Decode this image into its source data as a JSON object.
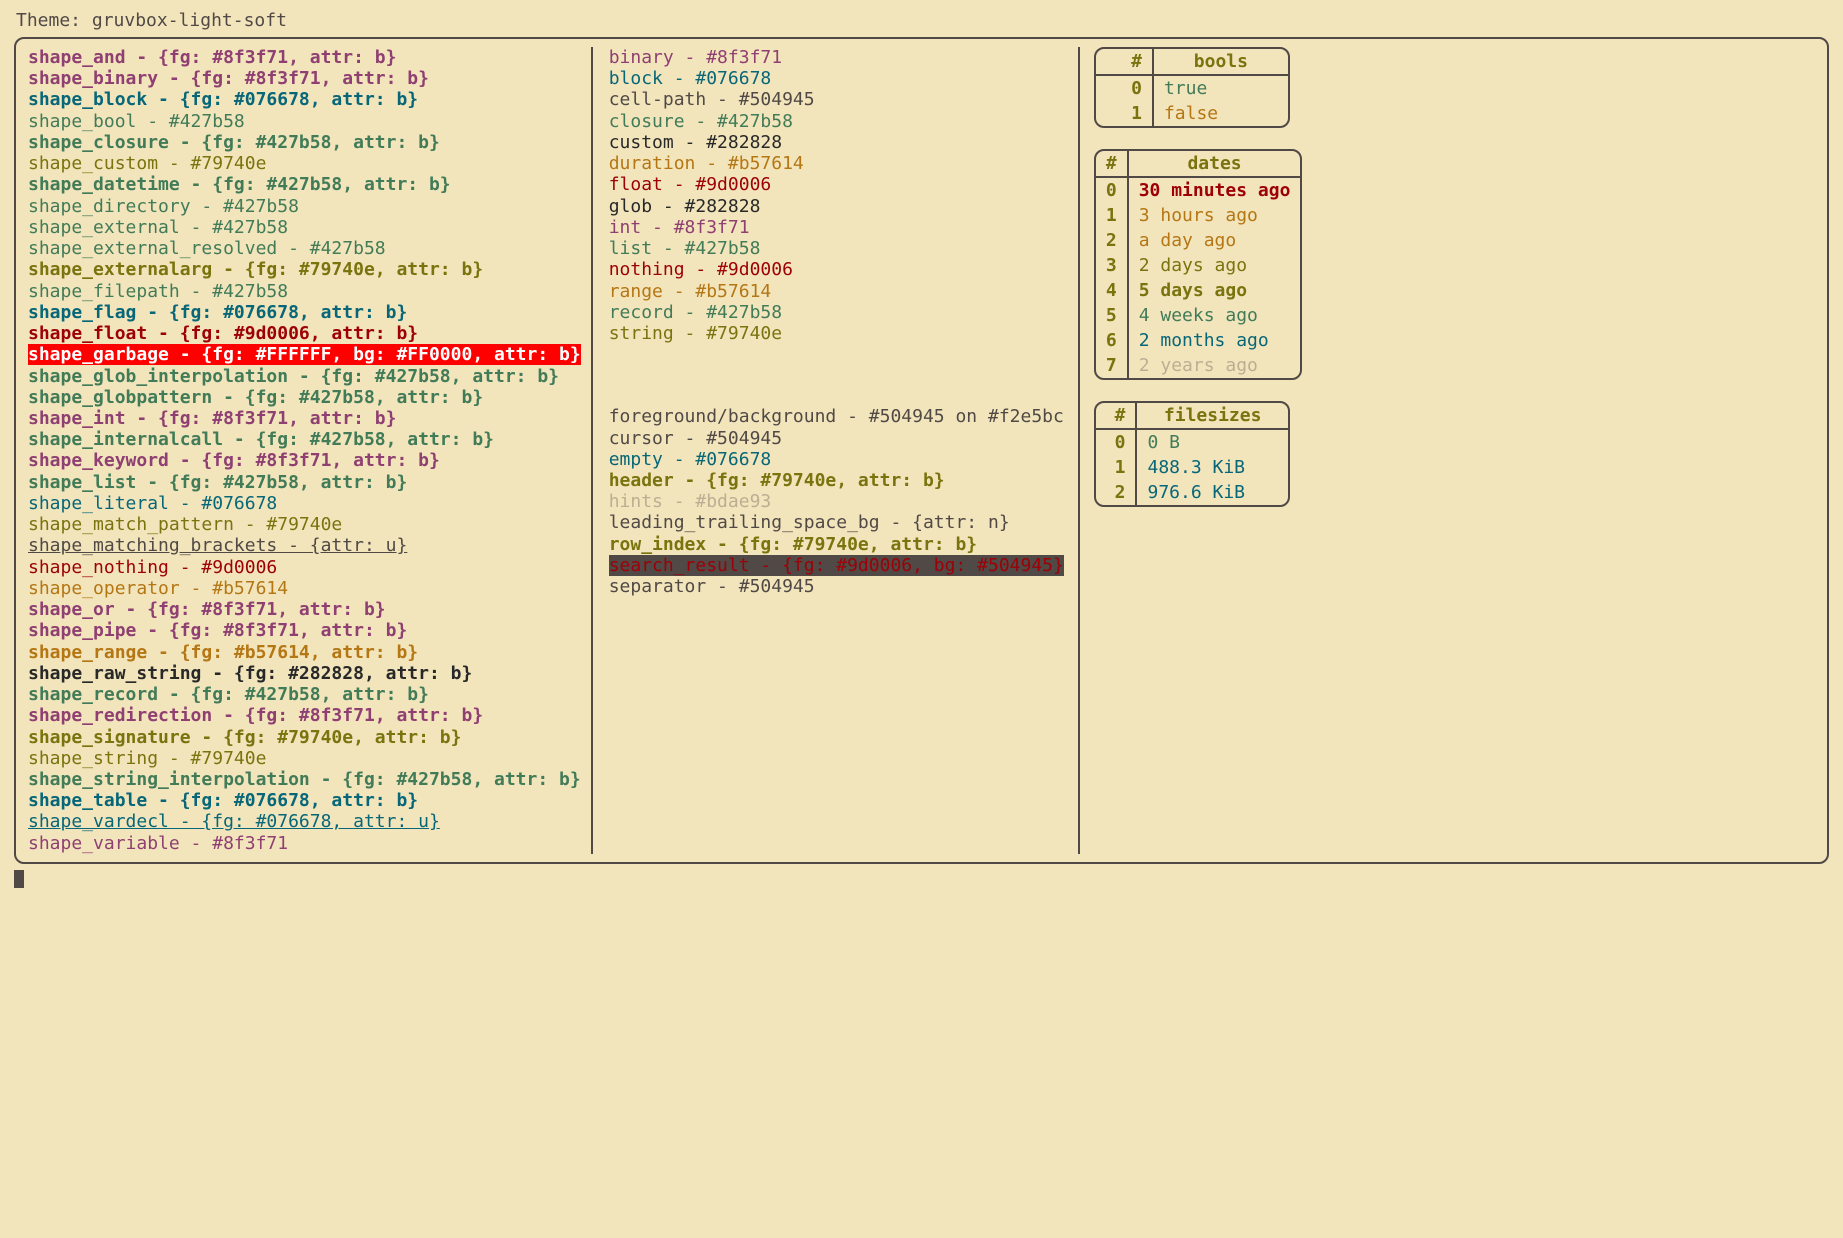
{
  "theme_label": "Theme: gruvbox-light-soft",
  "shapes": [
    {
      "name": "shape_and",
      "value": "{fg: #8f3f71, attr: b}",
      "color": "#8f3f71",
      "bold": true
    },
    {
      "name": "shape_binary",
      "value": "{fg: #8f3f71, attr: b}",
      "color": "#8f3f71",
      "bold": true
    },
    {
      "name": "shape_block",
      "value": "{fg: #076678, attr: b}",
      "color": "#076678",
      "bold": true
    },
    {
      "name": "shape_bool",
      "value": "#427b58",
      "color": "#427b58",
      "bold": false
    },
    {
      "name": "shape_closure",
      "value": "{fg: #427b58, attr: b}",
      "color": "#427b58",
      "bold": true
    },
    {
      "name": "shape_custom",
      "value": "#79740e",
      "color": "#79740e",
      "bold": false
    },
    {
      "name": "shape_datetime",
      "value": "{fg: #427b58, attr: b}",
      "color": "#427b58",
      "bold": true
    },
    {
      "name": "shape_directory",
      "value": "#427b58",
      "color": "#427b58",
      "bold": false
    },
    {
      "name": "shape_external",
      "value": "#427b58",
      "color": "#427b58",
      "bold": false
    },
    {
      "name": "shape_external_resolved",
      "value": "#427b58",
      "color": "#427b58",
      "bold": false
    },
    {
      "name": "shape_externalarg",
      "value": "{fg: #79740e, attr: b}",
      "color": "#79740e",
      "bold": true
    },
    {
      "name": "shape_filepath",
      "value": "#427b58",
      "color": "#427b58",
      "bold": false
    },
    {
      "name": "shape_flag",
      "value": "{fg: #076678, attr: b}",
      "color": "#076678",
      "bold": true
    },
    {
      "name": "shape_float",
      "value": "{fg: #9d0006, attr: b}",
      "color": "#9d0006",
      "bold": true
    },
    {
      "name": "shape_garbage",
      "value": "{fg: #FFFFFF, bg: #FF0000, attr: b}",
      "color": "#FFFFFF",
      "bg": "#FF0000",
      "bold": true
    },
    {
      "name": "shape_glob_interpolation",
      "value": "{fg: #427b58, attr: b}",
      "color": "#427b58",
      "bold": true
    },
    {
      "name": "shape_globpattern",
      "value": "{fg: #427b58, attr: b}",
      "color": "#427b58",
      "bold": true
    },
    {
      "name": "shape_int",
      "value": "{fg: #8f3f71, attr: b}",
      "color": "#8f3f71",
      "bold": true
    },
    {
      "name": "shape_internalcall",
      "value": "{fg: #427b58, attr: b}",
      "color": "#427b58",
      "bold": true
    },
    {
      "name": "shape_keyword",
      "value": "{fg: #8f3f71, attr: b}",
      "color": "#8f3f71",
      "bold": true
    },
    {
      "name": "shape_list",
      "value": "{fg: #427b58, attr: b}",
      "color": "#427b58",
      "bold": true
    },
    {
      "name": "shape_literal",
      "value": "#076678",
      "color": "#076678",
      "bold": false
    },
    {
      "name": "shape_match_pattern",
      "value": "#79740e",
      "color": "#79740e",
      "bold": false
    },
    {
      "name": "shape_matching_brackets",
      "value": "{attr: u}",
      "color": "#504945",
      "underline": true
    },
    {
      "name": "shape_nothing",
      "value": "#9d0006",
      "color": "#9d0006",
      "bold": false
    },
    {
      "name": "shape_operator",
      "value": "#b57614",
      "color": "#b57614",
      "bold": false
    },
    {
      "name": "shape_or",
      "value": "{fg: #8f3f71, attr: b}",
      "color": "#8f3f71",
      "bold": true
    },
    {
      "name": "shape_pipe",
      "value": "{fg: #8f3f71, attr: b}",
      "color": "#8f3f71",
      "bold": true
    },
    {
      "name": "shape_range",
      "value": "{fg: #b57614, attr: b}",
      "color": "#b57614",
      "bold": true
    },
    {
      "name": "shape_raw_string",
      "value": "{fg: #282828, attr: b}",
      "color": "#282828",
      "bold": true
    },
    {
      "name": "shape_record",
      "value": "{fg: #427b58, attr: b}",
      "color": "#427b58",
      "bold": true
    },
    {
      "name": "shape_redirection",
      "value": "{fg: #8f3f71, attr: b}",
      "color": "#8f3f71",
      "bold": true
    },
    {
      "name": "shape_signature",
      "value": "{fg: #79740e, attr: b}",
      "color": "#79740e",
      "bold": true
    },
    {
      "name": "shape_string",
      "value": "#79740e",
      "color": "#79740e",
      "bold": false
    },
    {
      "name": "shape_string_interpolation",
      "value": "{fg: #427b58, attr: b}",
      "color": "#427b58",
      "bold": true
    },
    {
      "name": "shape_table",
      "value": "{fg: #076678, attr: b}",
      "color": "#076678",
      "bold": true
    },
    {
      "name": "shape_vardecl",
      "value": "{fg: #076678, attr: u}",
      "color": "#076678",
      "underline": true
    },
    {
      "name": "shape_variable",
      "value": "#8f3f71",
      "color": "#8f3f71",
      "bold": false
    }
  ],
  "types": [
    {
      "name": "binary",
      "value": "#8f3f71",
      "color": "#8f3f71"
    },
    {
      "name": "block",
      "value": "#076678",
      "color": "#076678"
    },
    {
      "name": "cell-path",
      "value": "#504945",
      "color": "#504945"
    },
    {
      "name": "closure",
      "value": "#427b58",
      "color": "#427b58"
    },
    {
      "name": "custom",
      "value": "#282828",
      "color": "#282828"
    },
    {
      "name": "duration",
      "value": "#b57614",
      "color": "#b57614"
    },
    {
      "name": "float",
      "value": "#9d0006",
      "color": "#9d0006"
    },
    {
      "name": "glob",
      "value": "#282828",
      "color": "#282828"
    },
    {
      "name": "int",
      "value": "#8f3f71",
      "color": "#8f3f71"
    },
    {
      "name": "list",
      "value": "#427b58",
      "color": "#427b58"
    },
    {
      "name": "nothing",
      "value": "#9d0006",
      "color": "#9d0006"
    },
    {
      "name": "range",
      "value": "#b57614",
      "color": "#b57614"
    },
    {
      "name": "record",
      "value": "#427b58",
      "color": "#427b58"
    },
    {
      "name": "string",
      "value": "#79740e",
      "color": "#79740e"
    }
  ],
  "misc": [
    {
      "name": "foreground/background",
      "value": "#504945 on #f2e5bc",
      "color": "#504945"
    },
    {
      "name": "cursor",
      "value": "#504945",
      "color": "#504945"
    },
    {
      "name": "empty",
      "value": "#076678",
      "color": "#076678"
    },
    {
      "name": "header",
      "value": "{fg: #79740e, attr: b}",
      "color": "#79740e",
      "bold": true
    },
    {
      "name": "hints",
      "value": "#bdae93",
      "color": "#bdae93"
    },
    {
      "name": "leading_trailing_space_bg",
      "value": "{attr: n}",
      "color": "#504945"
    },
    {
      "name": "row_index",
      "value": "{fg: #79740e, attr: b}",
      "color": "#79740e",
      "bold": true
    },
    {
      "name": "search_result",
      "value": "{fg: #9d0006, bg: #504945}",
      "color": "#9d0006",
      "bg": "#504945"
    },
    {
      "name": "separator",
      "value": "#504945",
      "color": "#504945"
    }
  ],
  "tables": {
    "bools": {
      "header": [
        "#",
        "bools"
      ],
      "rows": [
        {
          "i": "0",
          "v": "true",
          "color": "#427b58"
        },
        {
          "i": "1",
          "v": "false",
          "color": "#b57614"
        }
      ]
    },
    "dates": {
      "header": [
        "#",
        "dates"
      ],
      "rows": [
        {
          "i": "0",
          "v": "30 minutes ago",
          "color": "#9d0006",
          "bold": true
        },
        {
          "i": "1",
          "v": "3 hours ago",
          "color": "#b57614"
        },
        {
          "i": "2",
          "v": "a day ago",
          "color": "#b57614"
        },
        {
          "i": "3",
          "v": "2 days ago",
          "color": "#79740e"
        },
        {
          "i": "4",
          "v": "5 days ago",
          "color": "#79740e",
          "bold": true
        },
        {
          "i": "5",
          "v": "4 weeks ago",
          "color": "#427b58"
        },
        {
          "i": "6",
          "v": "2 months ago",
          "color": "#076678"
        },
        {
          "i": "7",
          "v": "2 years ago",
          "color": "#bdae93"
        }
      ]
    },
    "filesizes": {
      "header": [
        "#",
        "filesizes"
      ],
      "rows": [
        {
          "i": "0",
          "v": "0 B",
          "color": "#427b58",
          "right": true
        },
        {
          "i": "1",
          "v": "488.3 KiB",
          "color": "#076678"
        },
        {
          "i": "2",
          "v": "976.6 KiB",
          "color": "#076678"
        }
      ]
    }
  }
}
